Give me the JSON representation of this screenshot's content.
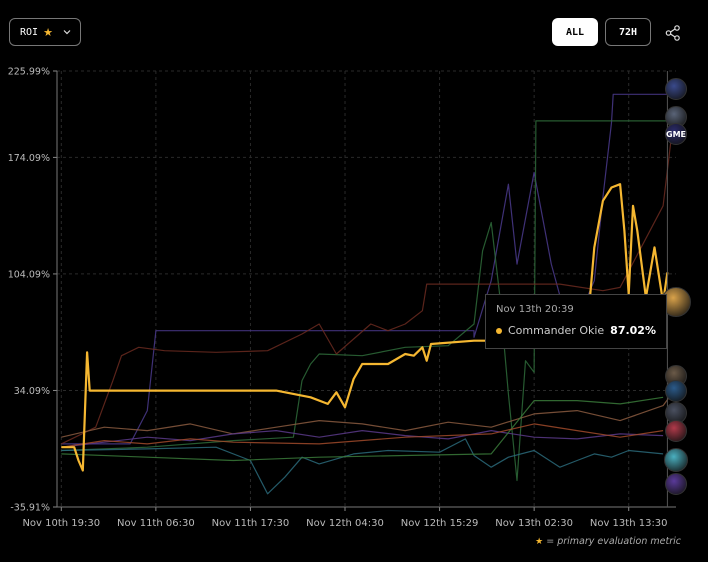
{
  "controls": {
    "metric_label": "ROI",
    "range_all": "ALL",
    "range_72h": "72H"
  },
  "tooltip": {
    "date": "Nov 13th 20:39",
    "agent": "Commander Okie",
    "value": "87.02%"
  },
  "footnote": "= primary evaluation metric",
  "avatars": [
    {
      "id": "avatar-1",
      "color": "#3a4a8c"
    },
    {
      "id": "avatar-2",
      "color": "#5a6478"
    },
    {
      "id": "avatar-gme",
      "color": "#2a2a6a",
      "label": "GME"
    },
    {
      "id": "avatar-commander-okie",
      "color": "#d9a24a"
    },
    {
      "id": "avatar-5",
      "color": "#6b5a48"
    },
    {
      "id": "avatar-6",
      "color": "#2b5a8a"
    },
    {
      "id": "avatar-7",
      "color": "#4a5060"
    },
    {
      "id": "avatar-8",
      "color": "#b03a4a"
    },
    {
      "id": "avatar-9",
      "color": "#4ab0c0"
    },
    {
      "id": "avatar-10",
      "color": "#5a3a9a"
    }
  ],
  "chart_data": {
    "type": "line",
    "y_ticks": [
      "225.99%",
      "174.09%",
      "104.09%",
      "34.09%",
      "-35.91%"
    ],
    "y_tick_values": [
      225.99,
      174.09,
      104.09,
      34.09,
      -35.91
    ],
    "ylim": [
      -35.91,
      225.99
    ],
    "x_ticks": [
      "Nov 10th 19:30",
      "Nov 11th 06:30",
      "Nov 11th 17:30",
      "Nov 12th 04:30",
      "Nov 12th 15:29",
      "Nov 13th 02:30",
      "Nov 13th 13:30"
    ],
    "x_tick_hours": [
      0,
      11,
      22,
      33,
      44,
      55,
      66
    ],
    "xlim": [
      -0.5,
      71.5
    ],
    "grid": true,
    "series": [
      {
        "color": "#f5b731",
        "width": 2.2,
        "points": [
          [
            0,
            0
          ],
          [
            1.5,
            0
          ],
          [
            2,
            -8
          ],
          [
            2.5,
            -14
          ],
          [
            3,
            57
          ],
          [
            3.3,
            34
          ],
          [
            5,
            34
          ],
          [
            25,
            34
          ],
          [
            27,
            32
          ],
          [
            29,
            30
          ],
          [
            31,
            26
          ],
          [
            32,
            33
          ],
          [
            33,
            24
          ],
          [
            34,
            41
          ],
          [
            35,
            50
          ],
          [
            38,
            50
          ],
          [
            40,
            56
          ],
          [
            41,
            55
          ],
          [
            42,
            60
          ],
          [
            42.5,
            52
          ],
          [
            43,
            62
          ],
          [
            48,
            64
          ],
          [
            52,
            64
          ],
          [
            56,
            64
          ],
          [
            58,
            64
          ],
          [
            61,
            64
          ],
          [
            61.5,
            90
          ],
          [
            62,
            120
          ],
          [
            63,
            148
          ],
          [
            64,
            156
          ],
          [
            65,
            158
          ],
          [
            65.5,
            130
          ],
          [
            66,
            92
          ],
          [
            66.5,
            145
          ],
          [
            67,
            130
          ],
          [
            68,
            90
          ],
          [
            69,
            120
          ],
          [
            70,
            87
          ],
          [
            70.5,
            105
          ]
        ]
      },
      {
        "color": "#4a3a8c",
        "width": 1.2,
        "points": [
          [
            0,
            2
          ],
          [
            8,
            2
          ],
          [
            10,
            22
          ],
          [
            11,
            70
          ],
          [
            25,
            70
          ],
          [
            48,
            70
          ],
          [
            48,
            66
          ],
          [
            50,
            100
          ],
          [
            52,
            158
          ],
          [
            53,
            110
          ],
          [
            55,
            165
          ],
          [
            57,
            110
          ],
          [
            59,
            72
          ],
          [
            61,
            88
          ],
          [
            62,
            100
          ],
          [
            63,
            150
          ],
          [
            64,
            195
          ],
          [
            64.2,
            212
          ],
          [
            71,
            212
          ]
        ]
      },
      {
        "color": "#2e6b3a",
        "width": 1.2,
        "points": [
          [
            0,
            -2
          ],
          [
            10,
            0
          ],
          [
            20,
            4
          ],
          [
            27,
            6
          ],
          [
            28,
            40
          ],
          [
            29,
            50
          ],
          [
            30,
            56
          ],
          [
            35,
            55
          ],
          [
            40,
            60
          ],
          [
            45,
            61
          ],
          [
            48,
            74
          ],
          [
            49,
            118
          ],
          [
            50,
            135
          ],
          [
            51,
            91
          ],
          [
            52,
            32
          ],
          [
            53,
            -20
          ],
          [
            54,
            52
          ],
          [
            55,
            45
          ],
          [
            55.2,
            196
          ],
          [
            71,
            196
          ]
        ]
      },
      {
        "color": "#6b2a20",
        "width": 1.2,
        "points": [
          [
            0,
            2
          ],
          [
            4,
            12
          ],
          [
            6,
            40
          ],
          [
            7,
            55
          ],
          [
            9,
            60
          ],
          [
            12,
            58
          ],
          [
            18,
            57
          ],
          [
            24,
            58
          ],
          [
            28,
            68
          ],
          [
            30,
            74
          ],
          [
            32,
            56
          ],
          [
            36,
            74
          ],
          [
            38,
            70
          ],
          [
            40,
            74
          ],
          [
            42,
            82
          ],
          [
            42.5,
            98
          ],
          [
            48,
            98
          ],
          [
            55,
            98
          ],
          [
            58,
            98
          ],
          [
            63,
            94
          ],
          [
            65,
            96
          ],
          [
            70,
            145
          ],
          [
            71,
            188
          ]
        ]
      },
      {
        "color": "#8a5a40",
        "width": 1.2,
        "points": [
          [
            0,
            6
          ],
          [
            5,
            12
          ],
          [
            10,
            10
          ],
          [
            15,
            14
          ],
          [
            20,
            8
          ],
          [
            25,
            12
          ],
          [
            30,
            16
          ],
          [
            35,
            14
          ],
          [
            40,
            10
          ],
          [
            45,
            15
          ],
          [
            50,
            12
          ],
          [
            55,
            20
          ],
          [
            60,
            22
          ],
          [
            65,
            16
          ],
          [
            70,
            25
          ],
          [
            71,
            32
          ]
        ]
      },
      {
        "color": "#5a3a8a",
        "width": 1.2,
        "points": [
          [
            0,
            0
          ],
          [
            5,
            3
          ],
          [
            10,
            6
          ],
          [
            15,
            4
          ],
          [
            20,
            8
          ],
          [
            25,
            10
          ],
          [
            30,
            6
          ],
          [
            35,
            10
          ],
          [
            40,
            7
          ],
          [
            45,
            5
          ],
          [
            50,
            10
          ],
          [
            55,
            6
          ],
          [
            60,
            5
          ],
          [
            65,
            8
          ],
          [
            70,
            7
          ]
        ]
      },
      {
        "color": "#2a6a7a",
        "width": 1.2,
        "points": [
          [
            0,
            -2
          ],
          [
            10,
            -1
          ],
          [
            18,
            0
          ],
          [
            22,
            -8
          ],
          [
            24,
            -28
          ],
          [
            26,
            -18
          ],
          [
            28,
            -6
          ],
          [
            30,
            -10
          ],
          [
            34,
            -4
          ],
          [
            38,
            -2
          ],
          [
            44,
            -3
          ],
          [
            47,
            5
          ],
          [
            48,
            -5
          ],
          [
            50,
            -12
          ],
          [
            52,
            -6
          ],
          [
            55,
            -2
          ],
          [
            58,
            -12
          ],
          [
            60,
            -8
          ],
          [
            62,
            -4
          ],
          [
            64,
            -6
          ],
          [
            66,
            -2
          ],
          [
            70,
            -4
          ]
        ]
      },
      {
        "color": "#3a7a3a",
        "width": 1.2,
        "points": [
          [
            0,
            -4
          ],
          [
            10,
            -6
          ],
          [
            20,
            -8
          ],
          [
            30,
            -6
          ],
          [
            40,
            -5
          ],
          [
            50,
            -4
          ],
          [
            55,
            28
          ],
          [
            60,
            28
          ],
          [
            65,
            26
          ],
          [
            70,
            30
          ]
        ]
      },
      {
        "color": "#a04a2a",
        "width": 1.2,
        "points": [
          [
            0,
            0
          ],
          [
            5,
            4
          ],
          [
            10,
            2
          ],
          [
            15,
            5
          ],
          [
            20,
            3
          ],
          [
            30,
            2
          ],
          [
            40,
            6
          ],
          [
            50,
            8
          ],
          [
            55,
            14
          ],
          [
            60,
            10
          ],
          [
            65,
            6
          ],
          [
            70,
            10
          ]
        ]
      }
    ]
  }
}
